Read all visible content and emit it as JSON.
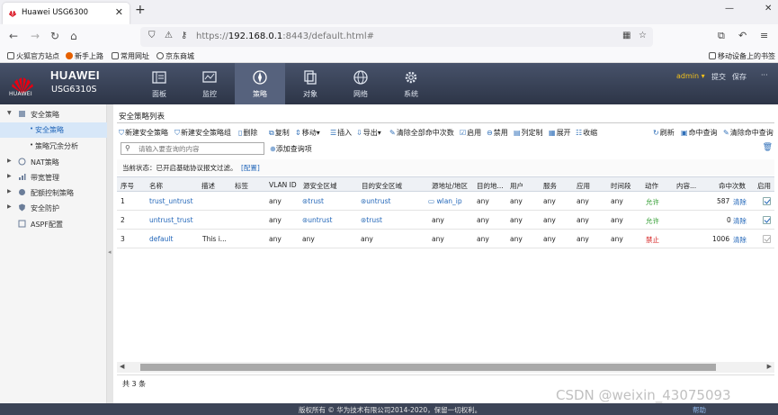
{
  "browser": {
    "tab_title": "Huawei USG6300",
    "close_glyph": "✕",
    "newtab_glyph": "+",
    "url_prefix": "https://",
    "url_host": "192.168.0.1",
    "url_rest": ":8443/default.html#",
    "bookmarks": [
      "火狐官方站点",
      "新手上路",
      "常用网址",
      "京东商城"
    ],
    "mobile_bookmarks": "移动设备上的书签"
  },
  "app": {
    "logo_text": "HUAWEI",
    "brand": "HUAWEI",
    "model": "USG6310S",
    "nav": [
      "面板",
      "监控",
      "策略",
      "对象",
      "网络",
      "系统"
    ],
    "active_nav": "策略",
    "user": "admin",
    "user_caret": "▾",
    "links": [
      "提交",
      "保存"
    ],
    "more": "···"
  },
  "sidebar": {
    "items": [
      {
        "label": "安全策略",
        "icon": "security-policy-icon",
        "expanded": true
      },
      {
        "label": "安全策略",
        "sub": true,
        "selected": true
      },
      {
        "label": "策略冗余分析",
        "sub": true
      },
      {
        "label": "NAT策略",
        "icon": "nat-icon"
      },
      {
        "label": "带宽管理",
        "icon": "bandwidth-icon"
      },
      {
        "label": "配额控制策略",
        "icon": "quota-icon"
      },
      {
        "label": "安全防护",
        "icon": "shield-icon"
      },
      {
        "label": "ASPF配置",
        "icon": "aspf-icon"
      }
    ]
  },
  "content": {
    "title": "安全策略列表",
    "toolbar": [
      "新建安全策略",
      "新建安全策略组",
      "删除",
      "复制",
      "移动",
      "插入",
      "导出",
      "清除全部命中次数",
      "启用",
      "禁用",
      "列定制",
      "展开",
      "收缩"
    ],
    "toolbar_right": [
      "刷新",
      "命中查询",
      "清除命中查询"
    ],
    "search_placeholder": "请输入要查询的内容",
    "add_query": "添加查询项",
    "status_label": "当前状态：已开启基础协议报文过滤。",
    "status_link": "[配置]",
    "columns": [
      "序号",
      "名称",
      "描述",
      "标签",
      "VLAN ID",
      "源安全区域",
      "目的安全区域",
      "源地址/地区",
      "目的地...",
      "用户",
      "服务",
      "应用",
      "时间段",
      "动作",
      "内容...",
      "命中次数",
      "启用"
    ],
    "rows": [
      {
        "id": "1",
        "name": "trust_untrust",
        "desc": "",
        "tag": "",
        "vlan": "any",
        "src_zone": "trust",
        "dst_zone": "untrust",
        "src_addr": "wlan_ip",
        "dst_addr": "any",
        "user": "any",
        "service": "any",
        "app": "any",
        "time": "any",
        "action": "允许",
        "content": "",
        "hits": "587",
        "clear": "清除",
        "enabled": true
      },
      {
        "id": "2",
        "name": "untrust_trust",
        "desc": "",
        "tag": "",
        "vlan": "any",
        "src_zone": "untrust",
        "dst_zone": "trust",
        "src_addr": "any",
        "dst_addr": "any",
        "user": "any",
        "service": "any",
        "app": "any",
        "time": "any",
        "action": "允许",
        "content": "",
        "hits": "0",
        "clear": "清除",
        "enabled": true
      },
      {
        "id": "3",
        "name": "default",
        "desc": "This i...",
        "tag": "",
        "vlan": "any",
        "src_zone": "any",
        "dst_zone": "any",
        "src_addr": "any",
        "dst_addr": "any",
        "user": "any",
        "service": "any",
        "app": "any",
        "time": "any",
        "action": "禁止",
        "content": "",
        "hits": "1006",
        "clear": "清除",
        "enabled": true
      }
    ],
    "total": "共 3 条"
  },
  "footer": {
    "copyright": "版权所有 © 华为技术有限公司2014-2020，保留一切权利。",
    "help": "帮助"
  },
  "watermark": "CSDN @weixin_43075093",
  "colors": {
    "header": "#2d3547",
    "allow": "#2e9b2e",
    "deny": "#d41d1d",
    "link": "#2266b9"
  }
}
